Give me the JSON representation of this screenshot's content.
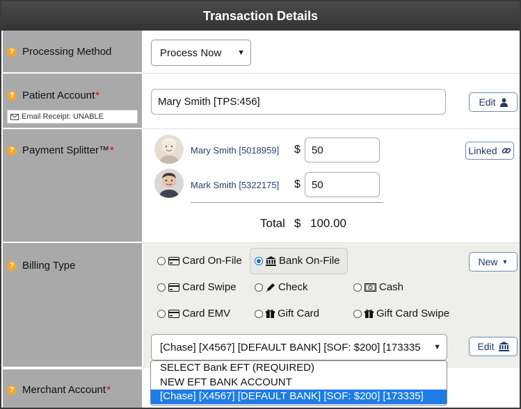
{
  "title": "Transaction Details",
  "processing": {
    "label": "Processing Method",
    "selected": "Process Now"
  },
  "patient": {
    "label": "Patient Account",
    "value": "Mary Smith [TPS:456]",
    "edit_label": "Edit",
    "email_receipt": "Email Receipt: UNABLE"
  },
  "splitter": {
    "label": "Payment Splitter™",
    "linked_label": "Linked",
    "people": [
      {
        "name": "Mary Smith [5018959]",
        "currency": "$",
        "amount": "50"
      },
      {
        "name": "Mark Smith [5322175]",
        "currency": "$",
        "amount": "50"
      }
    ],
    "total_label": "Total",
    "total_currency": "$",
    "total_value": "100.00"
  },
  "billing": {
    "label": "Billing Type",
    "new_label": "New",
    "edit_label": "Edit",
    "options": [
      {
        "label": "Card On-File",
        "checked": false,
        "icon": "credit-card-icon"
      },
      {
        "label": "Bank On-File",
        "checked": true,
        "icon": "bank-icon"
      },
      {
        "label": "Card Swipe",
        "checked": false,
        "icon": "credit-card-icon"
      },
      {
        "label": "Check",
        "checked": false,
        "icon": "pen-icon"
      },
      {
        "label": "Cash",
        "checked": false,
        "icon": "cash-icon"
      },
      {
        "label": "Card EMV",
        "checked": false,
        "icon": "credit-card-icon"
      },
      {
        "label": "Gift Card",
        "checked": false,
        "icon": "gift-icon"
      },
      {
        "label": "Gift Card Swipe",
        "checked": false,
        "icon": "gift-icon"
      }
    ],
    "account_selected": "[Chase] [X4567] [DEFAULT BANK] [SOF: $200] [173335",
    "dropdown_options": [
      "SELECT Bank EFT (REQUIRED)",
      "NEW EFT BANK ACCOUNT",
      "[Chase] [X4567] [DEFAULT BANK] [SOF: $200] [173335]"
    ],
    "dropdown_selected_index": 2
  },
  "merchant": {
    "label": "Merchant Account"
  },
  "colors": {
    "label_bg": "#a9a9a9",
    "billing_bg": "#eeeeea",
    "accent": "#1e7ce6",
    "required": "#dd0000",
    "help_icon": "#f0a830"
  }
}
